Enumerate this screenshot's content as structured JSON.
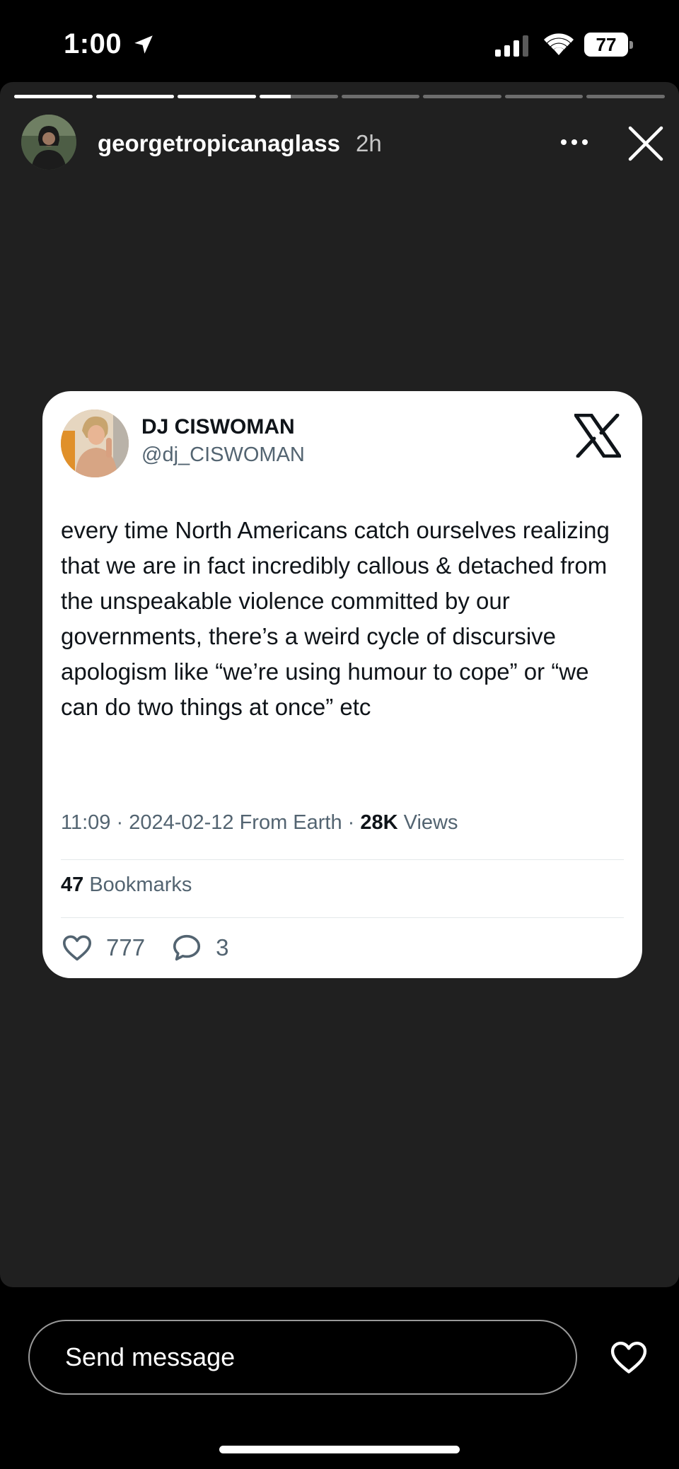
{
  "status_bar": {
    "time": "1:00",
    "battery": "77"
  },
  "story": {
    "progress": {
      "segments": [
        1,
        1,
        1,
        0.4,
        0,
        0,
        0,
        0
      ]
    },
    "header": {
      "username": "georgetropicanaglass",
      "time": "2h"
    },
    "tweet": {
      "name": "DJ CISWOMAN",
      "handle": "@dj_CISWOMAN",
      "text": "every time North Americans catch ourselves realizing that we are in fact incredibly callous & detached from the unspeakable violence committed by our governments, there’s a weird cycle of discursive apologism like “we’re using humour to cope” or “we can do two things at once” etc",
      "meta_prefix": "11:09 · 2024-02-12 From Earth · ",
      "views_count": "28K",
      "views_label": " Views",
      "bookmarks_count": "47",
      "bookmarks_label": " Bookmarks",
      "likes": "777",
      "replies": "3"
    }
  },
  "bottom": {
    "send_placeholder": "Send message"
  },
  "icons": {
    "location": "location-arrow-icon",
    "signal": "cellular-signal-icon",
    "wifi": "wifi-icon",
    "more": "more-icon",
    "close": "close-icon",
    "x_logo": "x-logo-icon",
    "like": "heart-icon",
    "reply": "reply-bubble-icon",
    "send_like": "heart-icon"
  },
  "colors": {
    "story_bg": "#202020",
    "card_bg": "#ffffff",
    "text_secondary": "#536471"
  }
}
